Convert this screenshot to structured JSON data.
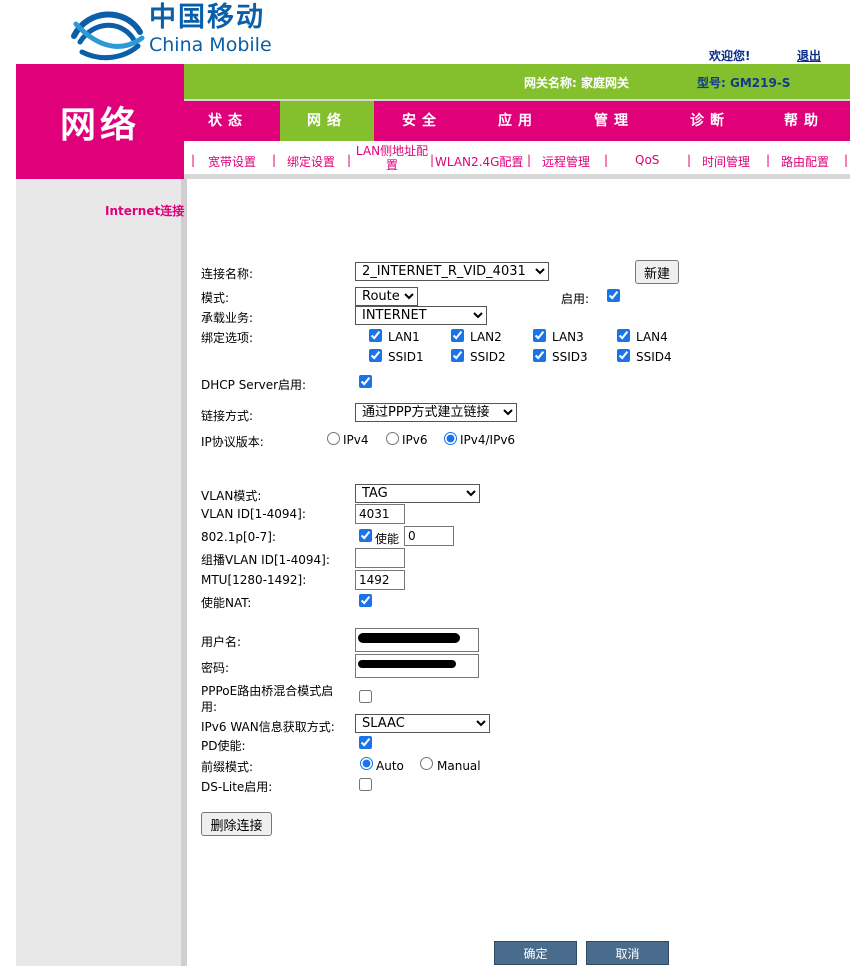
{
  "header": {
    "logo_cn": "中国移动",
    "logo_en": "China Mobile",
    "welcome": "欢迎您!",
    "logout": "退出",
    "brand": "网络",
    "gateway_name": "网关名称: 家庭网关",
    "model": "型号: GM219-S"
  },
  "nav": {
    "items": [
      "状态",
      "网络",
      "安全",
      "应用",
      "管理",
      "诊断",
      "帮助"
    ],
    "active": "网络"
  },
  "subnav": {
    "items": [
      "宽带设置",
      "绑定设置",
      "LAN侧地址配置",
      "WLAN2.4G配置",
      "远程管理",
      "QoS",
      "时间管理",
      "路由配置"
    ]
  },
  "sidebar": {
    "items": [
      "Internet连接"
    ]
  },
  "form": {
    "conn_name_label": "连接名称:",
    "conn_name_value": "2_INTERNET_R_VID_4031",
    "new_button": "新建",
    "mode_label": "模式:",
    "mode_value": "Route",
    "enable_label": "启用:",
    "service_label": "承载业务:",
    "service_value": "INTERNET",
    "bind_label": "绑定选项:",
    "bind_options": [
      "LAN1",
      "LAN2",
      "LAN3",
      "LAN4",
      "SSID1",
      "SSID2",
      "SSID3",
      "SSID4"
    ],
    "dhcp_label": "DHCP Server启用:",
    "link_label": "链接方式:",
    "link_value": "通过PPP方式建立链接",
    "ipver_label": "IP协议版本:",
    "ipver_options": [
      "IPv4",
      "IPv6",
      "IPv4/IPv6"
    ],
    "ipver_selected": "IPv4/IPv6",
    "vlan_mode_label": "VLAN模式:",
    "vlan_mode_value": "TAG",
    "vlan_id_label": "VLAN ID[1-4094]:",
    "vlan_id_value": "4031",
    "p8021_label": "802.1p[0-7]:",
    "p8021_enable": "使能",
    "p8021_value": "0",
    "mcast_vlan_label": "组播VLAN ID[1-4094]:",
    "mcast_vlan_value": "",
    "mtu_label": "MTU[1280-1492]:",
    "mtu_value": "1492",
    "nat_label": "使能NAT:",
    "user_label": "用户名:",
    "pass_label": "密码:",
    "pppoe_mix_label_1": "PPPoE路由桥混合模式启",
    "pppoe_mix_label_2": "用:",
    "ipv6wan_label": "IPv6 WAN信息获取方式:",
    "ipv6wan_value": "SLAAC",
    "pd_label": "PD使能:",
    "prefix_label": "前缀模式:",
    "prefix_options": [
      "Auto",
      "Manual"
    ],
    "prefix_selected": "Auto",
    "dslite_label": "DS-Lite启用:",
    "delete_button": "删除连接"
  },
  "footer": {
    "ok": "确定",
    "cancel": "取消"
  },
  "colors": {
    "magenta": "#e0007a",
    "green": "#84c02e",
    "blue": "#0a5fa8"
  }
}
